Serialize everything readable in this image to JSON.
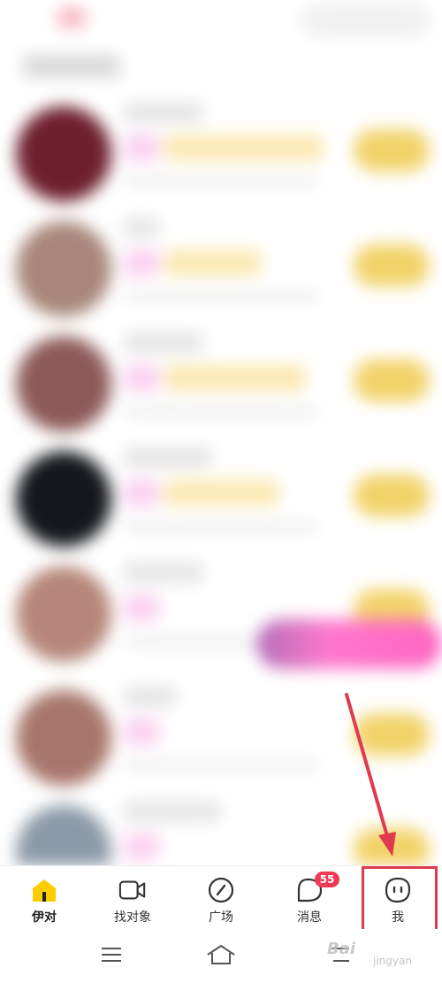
{
  "tabbar": {
    "items": [
      {
        "label": "伊对",
        "icon": "home-icon",
        "active": true
      },
      {
        "label": "找对象",
        "icon": "video-camera-icon"
      },
      {
        "label": "广场",
        "icon": "compass-icon"
      },
      {
        "label": "消息",
        "icon": "chat-bubble-icon",
        "badge": "55"
      },
      {
        "label": "我",
        "icon": "face-icon"
      }
    ]
  },
  "colors": {
    "accent_yellow": "#ffcc00",
    "badge_red": "#ee3a55",
    "annotation_red": "#e03a4e"
  },
  "list": {
    "avatar_colors": [
      "#6e1f2e",
      "#a8877a",
      "#8c5a58",
      "#15171c",
      "#b58679",
      "#a7766b",
      "#8b9aa8"
    ]
  },
  "watermark": {
    "text": "Bai",
    "sub": "jingyan"
  }
}
